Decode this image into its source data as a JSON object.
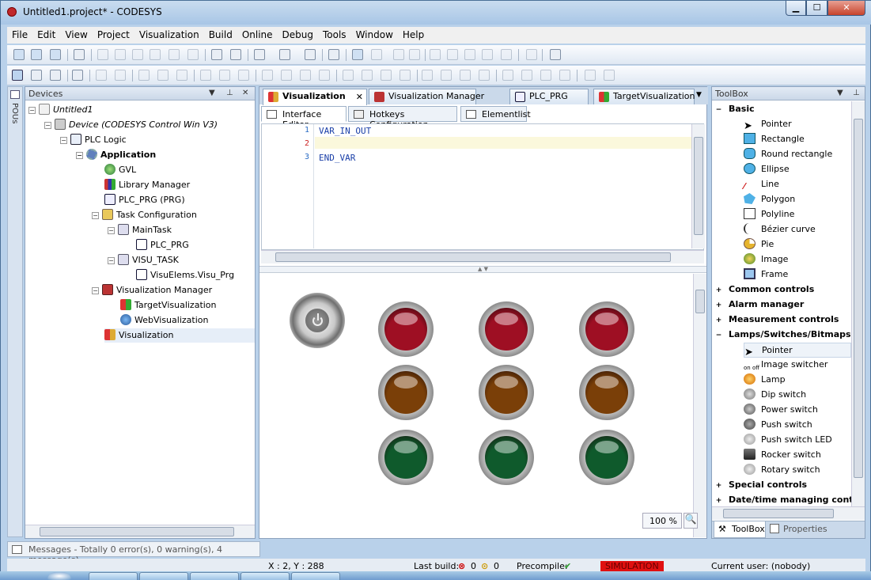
{
  "window": {
    "title": "Untitled1.project* - CODESYS"
  },
  "menu": [
    "File",
    "Edit",
    "View",
    "Project",
    "Visualization",
    "Build",
    "Online",
    "Debug",
    "Tools",
    "Window",
    "Help"
  ],
  "devices": {
    "title": "Devices",
    "side_tab": "POUs",
    "tree": [
      {
        "label": "Untitled1",
        "icon": "project-icon",
        "italic": true
      },
      {
        "label": "Device (CODESYS Control Win V3)",
        "icon": "device-icon",
        "italic": true
      },
      {
        "label": "PLC Logic",
        "icon": "plc-logic-icon"
      },
      {
        "label": "Application",
        "icon": "application-gear-icon",
        "bold": true
      },
      {
        "label": "GVL",
        "icon": "gvl-icon"
      },
      {
        "label": "Library Manager",
        "icon": "library-icon"
      },
      {
        "label": "PLC_PRG (PRG)",
        "icon": "program-icon"
      },
      {
        "label": "Task Configuration",
        "icon": "task-configuration-icon"
      },
      {
        "label": "MainTask",
        "icon": "task-icon"
      },
      {
        "label": "PLC_PRG",
        "icon": "program-call-icon"
      },
      {
        "label": "VISU_TASK",
        "icon": "task-icon"
      },
      {
        "label": "VisuElems.Visu_Prg",
        "icon": "program-call-icon"
      },
      {
        "label": "Visualization Manager",
        "icon": "visualization-manager-icon"
      },
      {
        "label": "TargetVisualization",
        "icon": "target-visualization-icon"
      },
      {
        "label": "WebVisualization",
        "icon": "web-visualization-icon"
      },
      {
        "label": "Visualization",
        "icon": "visualization-icon"
      }
    ]
  },
  "editor": {
    "tabs": [
      "Visualization",
      "Visualization Manager",
      "PLC_PRG",
      "TargetVisualization"
    ],
    "subtabs": [
      "Interface Editor",
      "Hotkeys Configuration",
      "Elementlist"
    ],
    "code_lines": [
      {
        "num": "1",
        "text": "VAR_IN_OUT"
      },
      {
        "num": "2",
        "text": ""
      },
      {
        "num": "3",
        "text": "END_VAR"
      }
    ],
    "zoom": "100 %"
  },
  "lamps": [
    {
      "color": "red"
    },
    {
      "color": "red"
    },
    {
      "color": "red"
    },
    {
      "color": "amber"
    },
    {
      "color": "amber"
    },
    {
      "color": "amber"
    },
    {
      "color": "green"
    },
    {
      "color": "green"
    },
    {
      "color": "green"
    }
  ],
  "toolbox": {
    "title": "ToolBox",
    "basic": {
      "label": "Basic",
      "items": [
        "Pointer",
        "Rectangle",
        "Round rectangle",
        "Ellipse",
        "Line",
        "Polygon",
        "Polyline",
        "Bézier curve",
        "Pie",
        "Image",
        "Frame"
      ]
    },
    "collapsed": [
      "Common controls",
      "Alarm manager",
      "Measurement controls"
    ],
    "lamps": {
      "label": "Lamps/Switches/Bitmaps",
      "items": [
        "Pointer",
        "Image switcher",
        "Lamp",
        "Dip switch",
        "Power switch",
        "Push switch",
        "Push switch LED",
        "Rocker switch",
        "Rotary switch"
      ]
    },
    "after": [
      "Special controls",
      "Date/time managing contr"
    ],
    "bottom_tabs": [
      "ToolBox",
      "Properties"
    ]
  },
  "messages": "Messages - Totally 0 error(s), 0 warning(s), 4 message(s)",
  "status": {
    "coords": "X : 2, Y : 288",
    "last_build_label": "Last build:",
    "errors": "0",
    "warnings": "0",
    "precompile": "Precompile:",
    "simulation": "SIMULATION",
    "user": "Current user: (nobody)"
  },
  "colors": {
    "lamp_red": "#9e0f23",
    "lamp_amber": "#7a3f08",
    "lamp_green": "#0f5a2c",
    "simulation": "#e01010"
  }
}
